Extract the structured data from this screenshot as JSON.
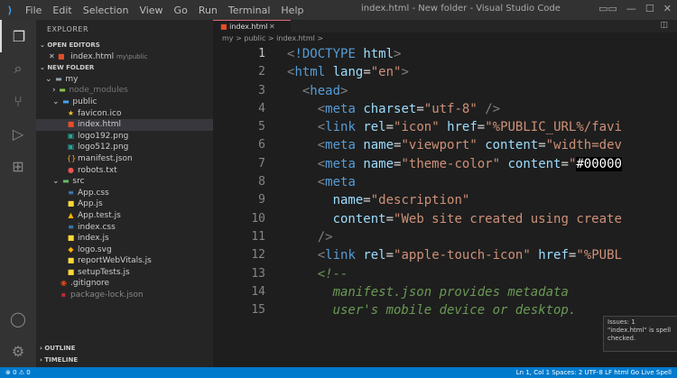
{
  "titlebar": {
    "menu": [
      "File",
      "Edit",
      "Selection",
      "View",
      "Go",
      "Run",
      "Terminal",
      "Help"
    ],
    "window_title": "index.html - New folder - Visual Studio Code"
  },
  "sidebar": {
    "title": "EXPLORER",
    "open_editors": "OPEN EDITORS",
    "open_file": "index.html",
    "open_file_path": "my\\public",
    "new_folder": "NEW FOLDER",
    "my": "my",
    "node_modules": "node_modules",
    "public": "public",
    "public_files": [
      "favicon.ico",
      "index.html",
      "logo192.png",
      "logo512.png",
      "manifest.json",
      "robots.txt"
    ],
    "src": "src",
    "src_files": [
      "App.css",
      "App.js",
      "App.test.js",
      "index.css",
      "index.js",
      "logo.svg",
      "reportWebVitals.js",
      "setupTests.js"
    ],
    "gitignore": ".gitignore",
    "package_lock": "package-lock.json",
    "outline": "OUTLINE",
    "timeline": "TIMELINE"
  },
  "editor": {
    "tab_label": "index.html",
    "breadcrumb": "my > public > index.html >",
    "line_numbers": [
      "1",
      "2",
      "3",
      "4",
      "5",
      "6",
      "7",
      "8",
      "9",
      "10",
      "11",
      "12",
      "13",
      "14",
      "15"
    ]
  },
  "hover": {
    "title": "Issues: 1",
    "text": "\"index.html\" is spell checked."
  },
  "statusbar": {
    "left": "⊗ 0 ⚠ 0",
    "right": "Ln 1, Col 1   Spaces: 2   UTF-8   LF   html   Go Live   Spell"
  },
  "icons": {
    "file_html": "html-file-icon",
    "file_css": "css-file-icon",
    "file_js": "js-file-icon"
  }
}
